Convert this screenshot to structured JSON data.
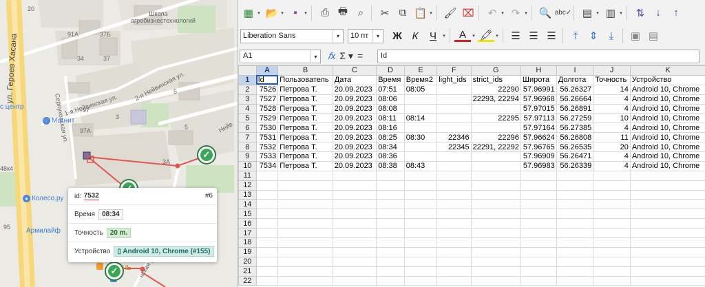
{
  "map": {
    "street_vertical": "ул. Героев Хасана",
    "school": "Школа агробизнестехнологий",
    "street_neivinskaya1": "1-я Нейвинская ул.",
    "street_neivinskaya2": "2-я Нейвинская ул.",
    "street_serpuhovskaya": "Серпуховская ул.",
    "street_neiv": "Нейв",
    "street_bottom": "нская ул.",
    "houses": [
      "20",
      "37Б",
      "91А",
      "37",
      "34",
      "97",
      "3",
      "97А",
      "3А",
      "5",
      "5",
      "48к4",
      "95"
    ],
    "poi_magnit": "Магнит",
    "poi_service": "с центр",
    "poi_koleso": "Колесо.ру",
    "poi_armilaif": "Армилайф",
    "poi_nch": "ОЧЬ",
    "poi_nch_prefix": "",
    "popup": {
      "id_label": "id:",
      "id_value": "7532",
      "tag": "#6",
      "time_label": "Время",
      "time_value": "08:34",
      "accuracy_label": "Точность",
      "accuracy_value": "20 m.",
      "device_label": "Устройство",
      "device_value": "Android 10, Chrome (#155)"
    }
  },
  "calc": {
    "font_name": "Liberation Sans",
    "font_size": "10 пт",
    "bold_label": "Ж",
    "italic_label": "К",
    "underline_label": "Ч",
    "name_box": "A1",
    "formula_content": "Id",
    "columns": [
      "A",
      "B",
      "C",
      "D",
      "E",
      "F",
      "G",
      "H",
      "I",
      "J",
      "K"
    ],
    "rows": [
      [
        "Id",
        "Пользователь",
        "Дата",
        "Время",
        "Время2",
        "light_ids",
        "strict_ids",
        "Широта",
        "Долгота",
        "Точность",
        "Устройство"
      ],
      [
        "7526",
        "Петрова Т.",
        "20.09.2023",
        "07:51",
        "08:05",
        "",
        "22290",
        "57.96991",
        "56.26327",
        "14",
        "Android 10, Chrome"
      ],
      [
        "7527",
        "Петрова Т.",
        "20.09.2023",
        "08:06",
        "",
        "",
        "22293, 22294",
        "57.96968",
        "56.26664",
        "4",
        "Android 10, Chrome"
      ],
      [
        "7528",
        "Петрова Т.",
        "20.09.2023",
        "08:08",
        "",
        "",
        "",
        "57.97015",
        "56.26891",
        "4",
        "Android 10, Chrome"
      ],
      [
        "7529",
        "Петрова Т.",
        "20.09.2023",
        "08:11",
        "08:14",
        "",
        "22295",
        "57.97113",
        "56.27259",
        "10",
        "Android 10, Chrome"
      ],
      [
        "7530",
        "Петрова Т.",
        "20.09.2023",
        "08:16",
        "",
        "",
        "",
        "57.97164",
        "56.27385",
        "4",
        "Android 10, Chrome"
      ],
      [
        "7531",
        "Петрова Т.",
        "20.09.2023",
        "08:25",
        "08:30",
        "22346",
        "22296",
        "57.96624",
        "56.26808",
        "11",
        "Android 10, Chrome"
      ],
      [
        "7532",
        "Петрова Т.",
        "20.09.2023",
        "08:34",
        "",
        "22345",
        "22291, 22292",
        "57.96765",
        "56.26535",
        "20",
        "Android 10, Chrome"
      ],
      [
        "7533",
        "Петрова Т.",
        "20.09.2023",
        "08:36",
        "",
        "",
        "",
        "57.96909",
        "56.26471",
        "4",
        "Android 10, Chrome"
      ],
      [
        "7534",
        "Петрова Т.",
        "20.09.2023",
        "08:38",
        "08:43",
        "",
        "",
        "57.96983",
        "56.26339",
        "4",
        "Android 10, Chrome"
      ]
    ],
    "row_numbers": [
      "1",
      "2",
      "3",
      "4",
      "5",
      "6",
      "7",
      "8",
      "9",
      "10",
      "11",
      "12",
      "13",
      "14",
      "15",
      "16",
      "17",
      "18",
      "19",
      "20",
      "21",
      "22"
    ]
  },
  "colors": {
    "map_bg": "#eceae4",
    "route": "#e0574f",
    "check_green": "#3aa656",
    "selection_blue": "#1f58c7"
  }
}
